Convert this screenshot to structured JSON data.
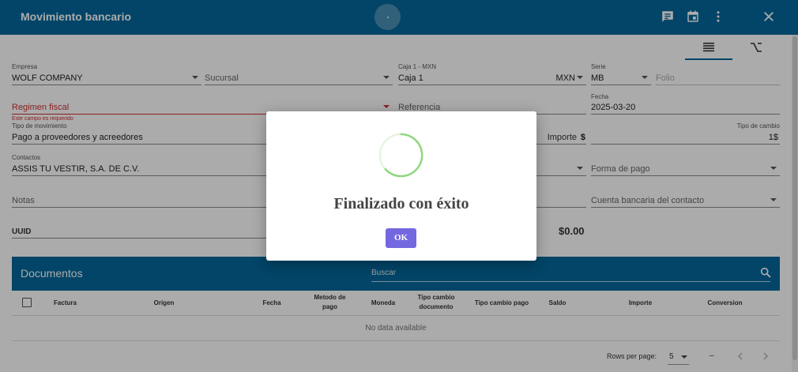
{
  "header": {
    "title": "Movimiento bancario",
    "icons": [
      "comment-icon",
      "calendar-icon",
      "more-vert-icon",
      "close-icon"
    ]
  },
  "form": {
    "empresa": {
      "label": "Empresa",
      "value": "WOLF COMPANY"
    },
    "sucursal": {
      "placeholder": "Sucursal"
    },
    "caja": {
      "label": "Caja 1 - MXN",
      "value": "Caja 1",
      "currency": "MXN"
    },
    "serie": {
      "label": "Serie",
      "value": "MB"
    },
    "folio": {
      "placeholder": "Folio"
    },
    "regimen": {
      "placeholder": "Regimen fiscal",
      "error": "Este campo es requerido"
    },
    "referencia": {
      "placeholder": "Referencia"
    },
    "fecha": {
      "label": "Fecha",
      "value": "2025-03-20"
    },
    "tipo_movimiento": {
      "label": "Tipo de movimiento",
      "value": "Pago a proveedores y acreedores"
    },
    "importe": {
      "label": "Importe",
      "symbol": "$"
    },
    "tipo_cambio": {
      "label": "Tipo de cambio",
      "value": "1$"
    },
    "contactos": {
      "label": "Contactos",
      "value": "ASSIS TU VESTIR, S.A. DE C.V."
    },
    "forma_pago": {
      "placeholder": "Forma de pago"
    },
    "notas": {
      "placeholder": "Notas"
    },
    "cuenta_bancaria": {
      "placeholder": "Cuenta bancaria del contacto"
    },
    "uuid": {
      "label": "UUID"
    },
    "total": "$0.00"
  },
  "documents": {
    "title": "Documentos",
    "search_placeholder": "Buscar",
    "columns": [
      "Factura",
      "Origen",
      "Fecha",
      "Metodo de pago",
      "Moneda",
      "Tipo cambio documento",
      "Tipo cambio pago",
      "Saldo",
      "Importe",
      "Conversion"
    ],
    "empty": "No data available",
    "rows_per_page_label": "Rows per page:",
    "rows_per_page": "5",
    "range": "–"
  },
  "dialog": {
    "title": "Finalizado con éxito",
    "ok_label": "OK",
    "spinner_color": "#8fd67e"
  },
  "colors": {
    "header": "#04679b",
    "accent": "#7468e0",
    "error": "#d32f2f"
  }
}
